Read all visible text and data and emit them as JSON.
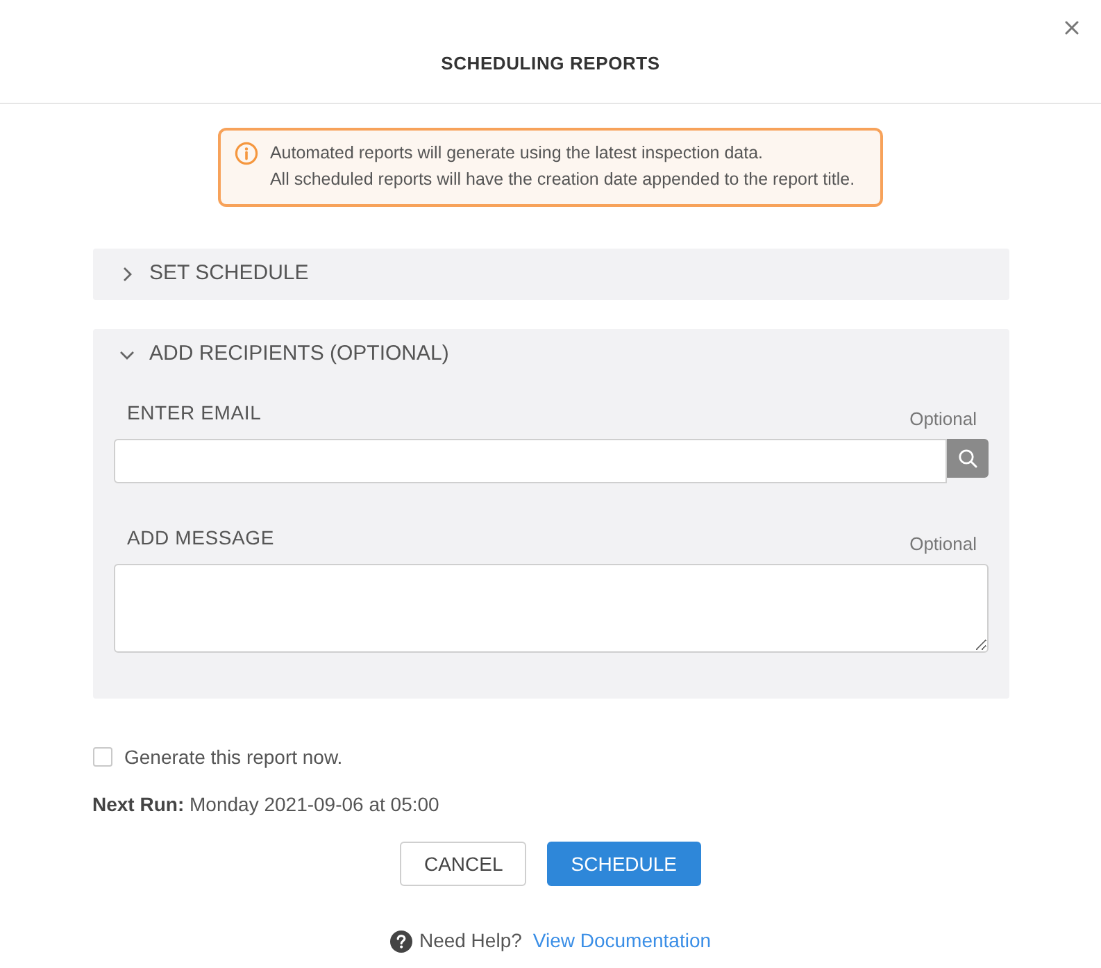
{
  "dialog": {
    "title": "SCHEDULING REPORTS"
  },
  "alert": {
    "lines": [
      "Automated reports will generate using the latest inspection data.",
      "All scheduled reports will have the creation date appended to the report title."
    ]
  },
  "sections": [
    {
      "title": "SET SCHEDULE",
      "expanded": false
    },
    {
      "title": "ADD RECIPIENTS (OPTIONAL)",
      "expanded": true,
      "fields": [
        {
          "kind": "search",
          "label": "ENTER EMAIL",
          "note": "Optional"
        },
        {
          "kind": "textarea",
          "label": "ADD MESSAGE",
          "note": "Optional"
        }
      ]
    }
  ],
  "generate_now": {
    "label": "Generate this report now.",
    "checked": false
  },
  "next_run": "**Next Run:** Monday 2021-09-06 at 05:00",
  "buttons": [
    {
      "label": "CANCEL",
      "kind": "cancel"
    },
    {
      "label": "SCHEDULE",
      "kind": "confirm"
    }
  ],
  "help": {
    "text": "Need Help?",
    "link": "View Documentation"
  }
}
